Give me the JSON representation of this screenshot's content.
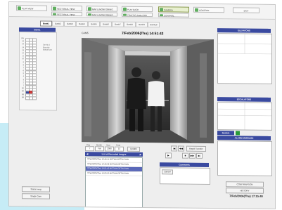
{
  "toolbar": {
    "buttons": [
      "PLAN VIEW",
      "SECTIONAL VIEW",
      "MAP & MONITORING",
      "PLAY BACK",
      "CAMERA",
      "CONTROL",
      "EXIT"
    ],
    "buttons_row2": [
      "SECTIONAL VIEW",
      "MAP & MONITORING",
      "TRAFFIC ANALYSIS",
      "CONTROL"
    ],
    "selected": "CAMERA"
  },
  "tabs": [
    "Bank1",
    "Bank2",
    "Bank3",
    "Bank4",
    "Bank5",
    "Bank6",
    "Bank7",
    "Bank8",
    "Bank9",
    "Bank10"
  ],
  "left": {
    "header": "Bank1",
    "info": [
      "Car No.1",
      "Floor B2",
      "Status Auto"
    ],
    "floors": [
      "B4",
      "B3",
      "B2",
      "B1",
      "1",
      "2",
      "3",
      "4",
      "5",
      "6",
      "7",
      "8",
      "9",
      "10",
      "11",
      "12",
      "13",
      "14",
      "15",
      "16",
      "PH"
    ],
    "buttons": [
      "Status msg",
      "Single Cam"
    ]
  },
  "camera": {
    "label": "CAM5",
    "timestamp": "7/Feb/2006(Thu) 14:51:43"
  },
  "search": {
    "labels": [
      "Day",
      "Month",
      "Year",
      "Time"
    ],
    "values": [
      "7",
      "Feb",
      "2006",
      "15"
    ],
    "update": "Update"
  },
  "recorded": {
    "title": "List of Recorded Images",
    "rows": [
      "7/Feb/2006(Thu)  14:42:11  MOTION DETECTION",
      "7/Feb/2006(Thu)  14:45:08  MOTION DETECTION",
      "7/Feb/2006(Thu)  14:51:43  MOTION DETECTION",
      "7/Feb/2006(Thu)  14:55:20  MOTION DETECTION"
    ]
  },
  "playback": {
    "rapid": "Rapid Transfer",
    "controls": [
      "|◀",
      "◀◀",
      "▶",
      "■",
      "▶▶",
      "▶|"
    ]
  },
  "comment": {
    "title": "Comments",
    "btn": "Cancel"
  },
  "right": {
    "elevators": "ELEVATORS",
    "escalators": "ESCALATORS",
    "system": "System",
    "alarm": "ALARM MESSAGE",
    "confirm": "CONFIRMATION",
    "history": "HISTORY",
    "clock": "7/Feb/2006(Thu) 17:15:40"
  }
}
